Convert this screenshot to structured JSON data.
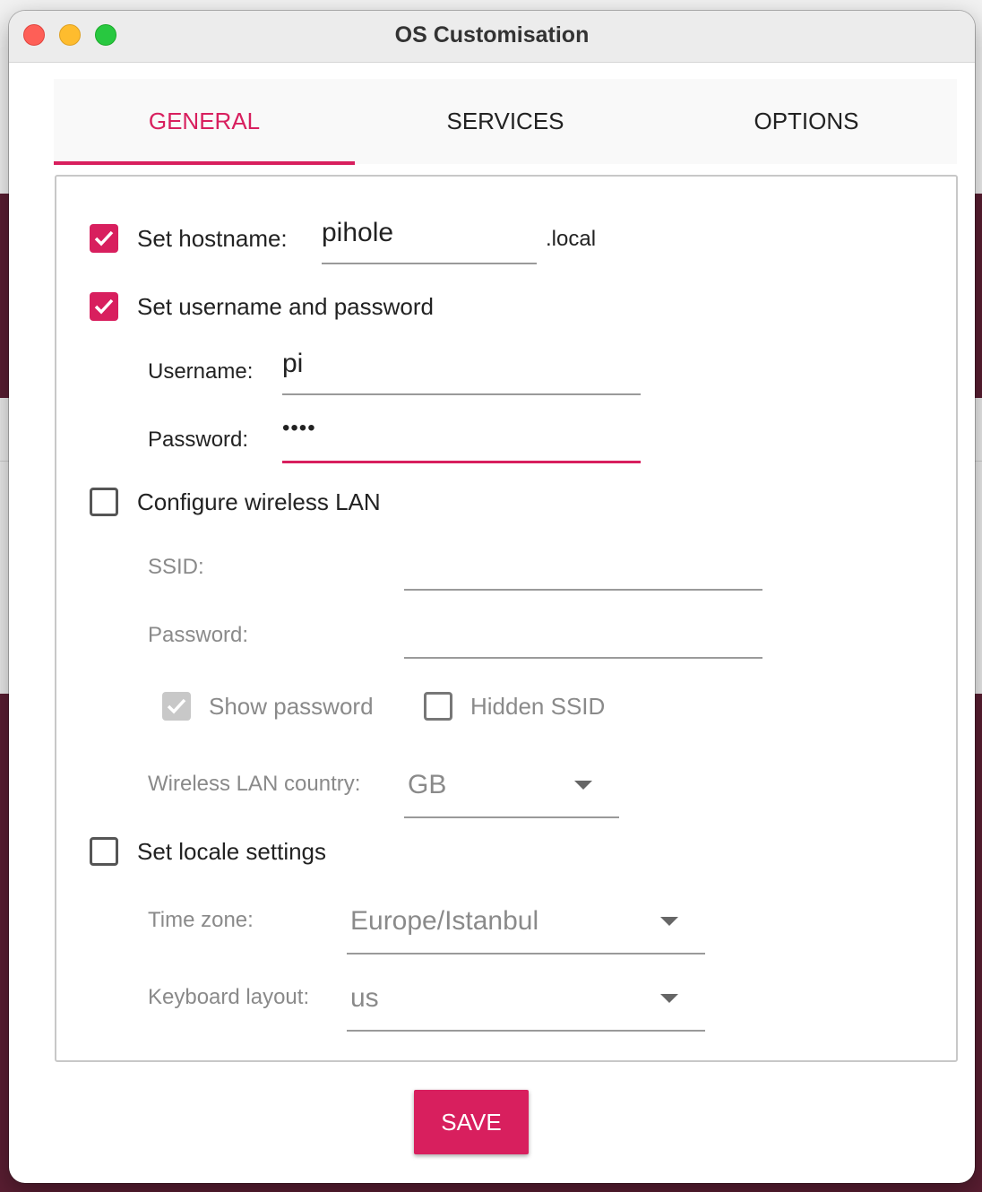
{
  "window": {
    "title": "OS Customisation"
  },
  "tabs": [
    {
      "label": "GENERAL",
      "active": true
    },
    {
      "label": "SERVICES",
      "active": false
    },
    {
      "label": "OPTIONS",
      "active": false
    }
  ],
  "general": {
    "hostname": {
      "label": "Set hostname:",
      "checked": true,
      "value": "pihole",
      "suffix": ".local"
    },
    "user": {
      "label": "Set username and password",
      "checked": true,
      "username_label": "Username:",
      "username_value": "pi",
      "password_label": "Password:",
      "password_value": "••••"
    },
    "wifi": {
      "label": "Configure wireless LAN",
      "checked": false,
      "ssid_label": "SSID:",
      "ssid_value": "",
      "password_label": "Password:",
      "password_value": "",
      "show_password_label": "Show password",
      "show_password_checked": true,
      "hidden_ssid_label": "Hidden SSID",
      "hidden_ssid_checked": false,
      "country_label": "Wireless LAN country:",
      "country_value": "GB"
    },
    "locale": {
      "label": "Set locale settings",
      "checked": false,
      "timezone_label": "Time zone:",
      "timezone_value": "Europe/Istanbul",
      "keyboard_label": "Keyboard layout:",
      "keyboard_value": "us"
    }
  },
  "actions": {
    "save_label": "SAVE"
  },
  "colors": {
    "accent": "#d81f5e",
    "disabled_text": "#8a8a8a"
  }
}
